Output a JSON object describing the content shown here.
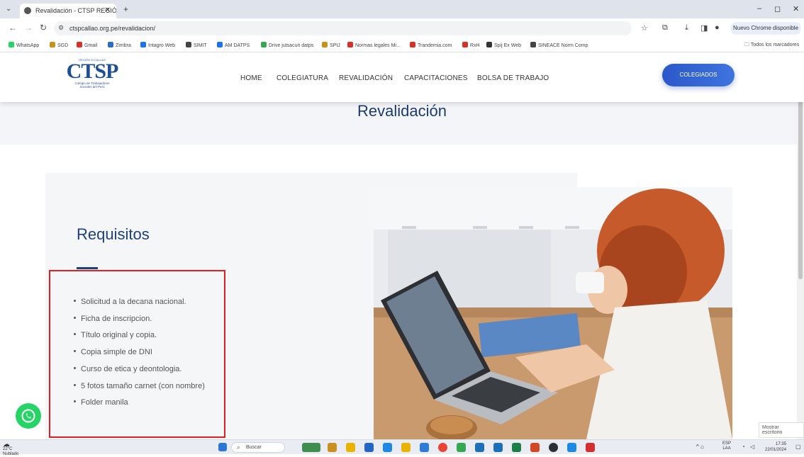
{
  "browser": {
    "tab_title": "Revalidación - CTSP REGIÓN XI",
    "tab_close": "✕",
    "new_tab": "+",
    "url": "ctspcallao.org.pe/revalidacion/",
    "update_button": "Nuevo Chrome disponible",
    "window_min": "–",
    "window_max": "◻",
    "window_close": "✕"
  },
  "bookmarks": [
    {
      "label": "WhatsApp",
      "color": "#25d366"
    },
    {
      "label": "SGD",
      "color": "#c8901e"
    },
    {
      "label": "Gmail",
      "color": "#d93025"
    },
    {
      "label": "Zimbra",
      "color": "#2b6cc4"
    },
    {
      "label": "Intagro Web",
      "color": "#1a73e8"
    },
    {
      "label": "SIMIT",
      "color": "#444444"
    },
    {
      "label": "AM DATPS",
      "color": "#1a73e8"
    },
    {
      "label": "Drive jutsacuri datps",
      "color": "#34a853"
    },
    {
      "label": "SPIJ",
      "color": "#c8901e"
    },
    {
      "label": "Normas legales Mi...",
      "color": "#d93025"
    },
    {
      "label": "Trandemia.com",
      "color": "#d93025"
    },
    {
      "label": "RxH",
      "color": "#d93025"
    },
    {
      "label": "Spij Ex Web",
      "color": "#333333"
    },
    {
      "label": "SINEACE Norm Comp",
      "color": "#444444"
    }
  ],
  "bookmarks_folder": "Todos los marcadores",
  "site": {
    "logo_top": "REGIÓN XI CALLAO",
    "logo_brand": "CTSP",
    "logo_sub1": "Colegio de Trabajadores",
    "logo_sub2": "Sociales del Perú",
    "nav": [
      "HOME",
      "COLEGIATURA",
      "REVALIDACIÓN",
      "CAPACITACIONES",
      "BOLSA DE TRABAJO"
    ],
    "cta": "COLEGIADOS"
  },
  "page": {
    "title": "Revalidación",
    "section_title": "Requisitos",
    "requirements": [
      "Solicitud a la decana nacional.",
      "Ficha de inscripcion.",
      "Título original y copia.",
      "Copia simple de DNI",
      "Curso de etica y deontologia.",
      "5 fotos tamaño carnet (con nombre)",
      "Folder manila"
    ]
  },
  "overlay": {
    "show_desktop": "Mostrar escritorio"
  },
  "taskbar": {
    "temp": "22°C",
    "weather": "Nublado",
    "search": "Buscar",
    "lang_top": "ESP",
    "lang_bottom": "LAA",
    "time": "17:35",
    "date": "22/01/2024"
  }
}
